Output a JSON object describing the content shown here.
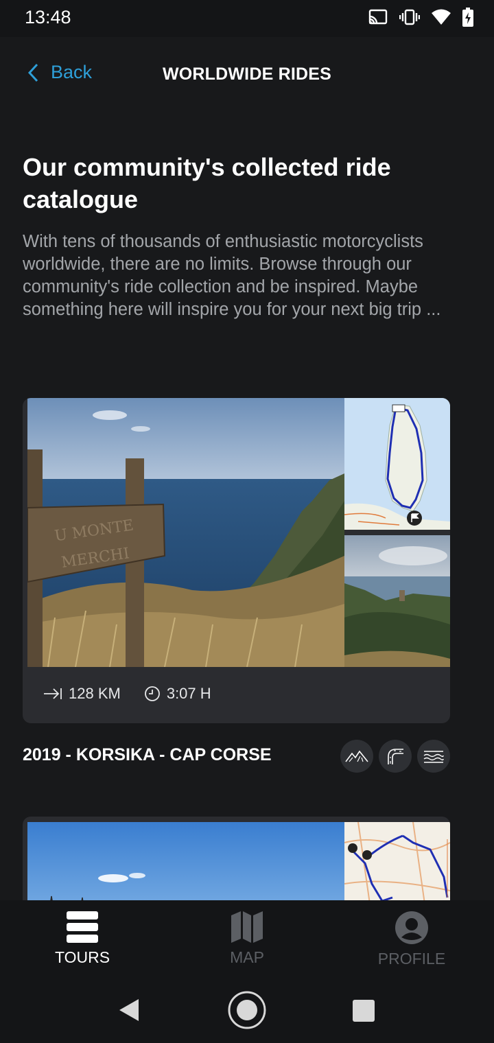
{
  "status_bar": {
    "time": "13:48"
  },
  "header": {
    "back_label": "Back",
    "title": "WORLDWIDE RIDES"
  },
  "intro": {
    "heading": "Our community's collected ride catalogue",
    "text": "With tens of thousands of enthusiastic motorcyclists worldwide, there are no limits. Browse through our community's ride collection and be inspired. Maybe something here will inspire you for your next big trip ..."
  },
  "rides": [
    {
      "distance": "128 KM",
      "duration": "3:07 H",
      "title": "2019 - KORSIKA - CAP CORSE",
      "tags": [
        "mountains-icon",
        "curves-icon",
        "coast-icon"
      ]
    }
  ],
  "bottom_nav": {
    "tours": "TOURS",
    "map": "MAP",
    "profile": "PROFILE",
    "active": "tours"
  },
  "colors": {
    "accent": "#2e9fd8",
    "background": "#18191b",
    "card": "#2b2c30",
    "muted": "#a3a6aa"
  }
}
